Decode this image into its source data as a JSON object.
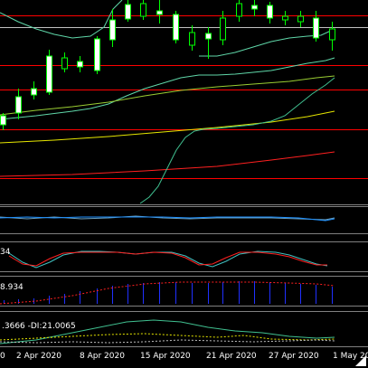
{
  "colors": {
    "background": "#000000",
    "separator": "#808080",
    "candle_up_body": "#ffffff",
    "candle_down_body": "#000000",
    "candle_wick": "#00ff00",
    "horizontal_level": "#ff0000",
    "price_line": "#c0c0c0",
    "ma_fast": "#5fd6a8",
    "ma_medium": "#9acd32",
    "ma_yellow": "#e6e600",
    "ma_red": "#ff2020",
    "ma_long": "#40c090",
    "cci_main": "#1e90ff",
    "cci_signal": "#6aa0c0",
    "stoch_main": "#ff2020",
    "stoch_signal": "#40c0c0",
    "bars": "#2030ff",
    "bars_dots": "#ff2020",
    "adx_main": "#40c090",
    "adx_plus": "#e6e600",
    "adx_minus": "#c0c0c0"
  },
  "indicators": {
    "stoch_value_text": "34",
    "bars_value_text": "8.934",
    "adx_value_text": ".3666 -DI:21.0065"
  },
  "date_axis": {
    "labels": [
      "0",
      "2 Apr 2020",
      "8 Apr 2020",
      "15 Apr 2020",
      "21 Apr 2020",
      "27 Apr 2020",
      "1 May 20"
    ]
  },
  "scroll_indicator_icon": "triangle-corner-icon"
}
